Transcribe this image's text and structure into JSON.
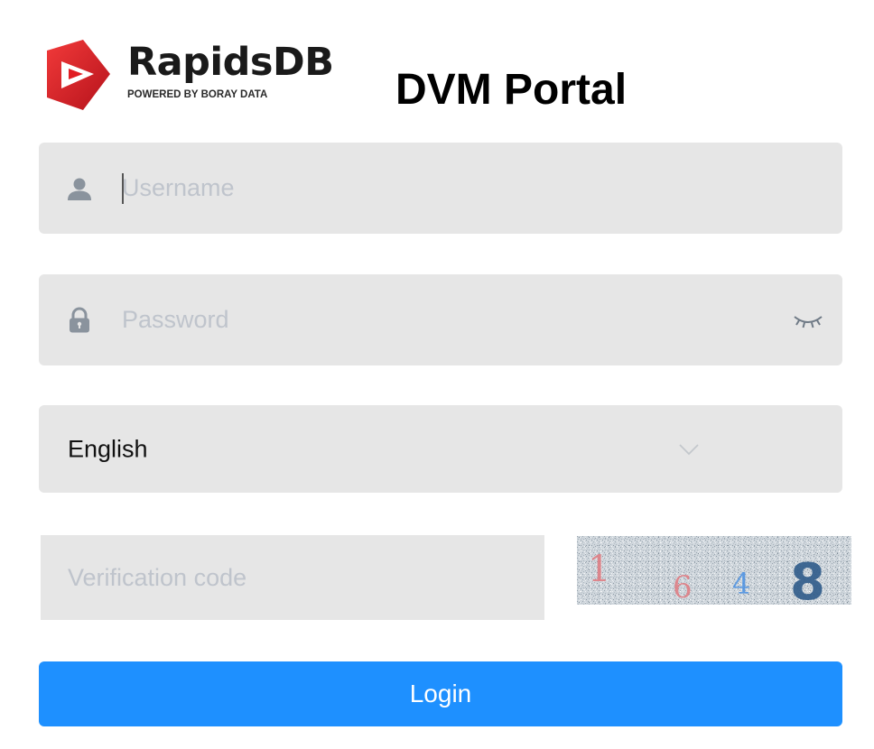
{
  "brand": {
    "name": "RapidsDB",
    "tagline": "POWERED BY BORAY DATA",
    "logo_color": "#e11d23"
  },
  "title": "DVM Portal",
  "form": {
    "username": {
      "placeholder": "Username",
      "value": "",
      "icon": "user-icon"
    },
    "password": {
      "placeholder": "Password",
      "value": "",
      "icon": "lock-icon",
      "toggle_icon": "eye-closed-icon"
    },
    "language": {
      "selected": "English",
      "icon": "chevron-down-icon"
    },
    "verification": {
      "placeholder": "Verification code",
      "value": ""
    },
    "captcha": {
      "digits": [
        "1",
        "6",
        "4",
        "8"
      ],
      "digit_colors": [
        "#e07a80",
        "#e07a80",
        "#4a90e2",
        "#2f5b8a"
      ]
    },
    "login_label": "Login"
  },
  "colors": {
    "field_bg": "#e6e6e6",
    "primary": "#1e90ff",
    "icon_gray": "#8a939d",
    "placeholder": "#bfc4cc"
  }
}
